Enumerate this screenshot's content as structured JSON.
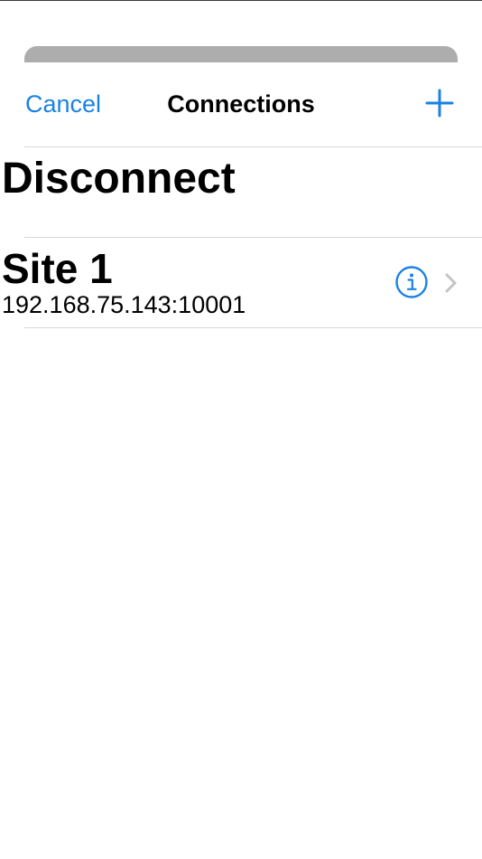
{
  "nav": {
    "cancel_label": "Cancel",
    "title": "Connections",
    "add_icon": "plus-icon"
  },
  "list": {
    "disconnect_label": "Disconnect",
    "connections": [
      {
        "name": "Site 1",
        "address": "192.168.75.143:10001",
        "info_icon": "info-circle-icon",
        "accessory_icon": "chevron-right-icon"
      }
    ]
  },
  "colors": {
    "accent": "#1a82e0",
    "separator": "#d8d8da",
    "grabber": "#adadad",
    "chevron": "#c4c4c7"
  }
}
